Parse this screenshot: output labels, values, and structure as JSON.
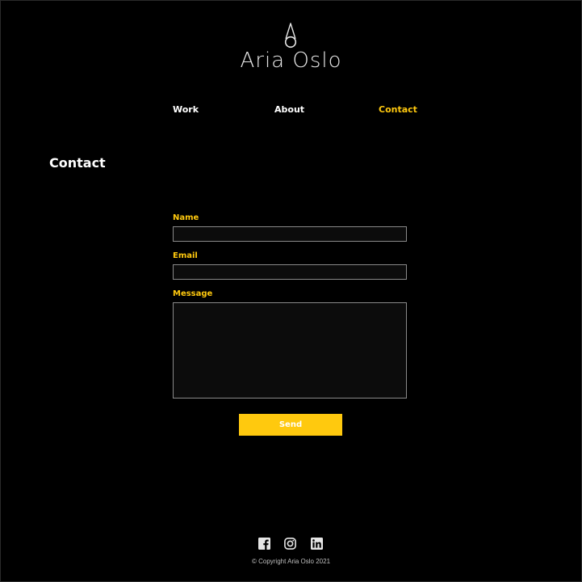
{
  "brand": {
    "name": "Aria Oslo",
    "logo_icon": "teardrop-ring-icon"
  },
  "nav": {
    "items": [
      "Work",
      "About",
      "Contact"
    ],
    "active": "Contact"
  },
  "page": {
    "title": "Contact"
  },
  "form": {
    "name_label": "Name",
    "email_label": "Email",
    "message_label": "Message",
    "name_value": "",
    "email_value": "",
    "message_value": "",
    "send_label": "Send"
  },
  "footer": {
    "social_icons": [
      "facebook-icon",
      "instagram-icon",
      "linkedin-icon"
    ],
    "copyright": "© Copyright Aria Oslo 2021"
  },
  "colors": {
    "background": "#000000",
    "accent": "#ffc90e",
    "text": "#ffffff",
    "field_border": "#8a8a8a"
  }
}
